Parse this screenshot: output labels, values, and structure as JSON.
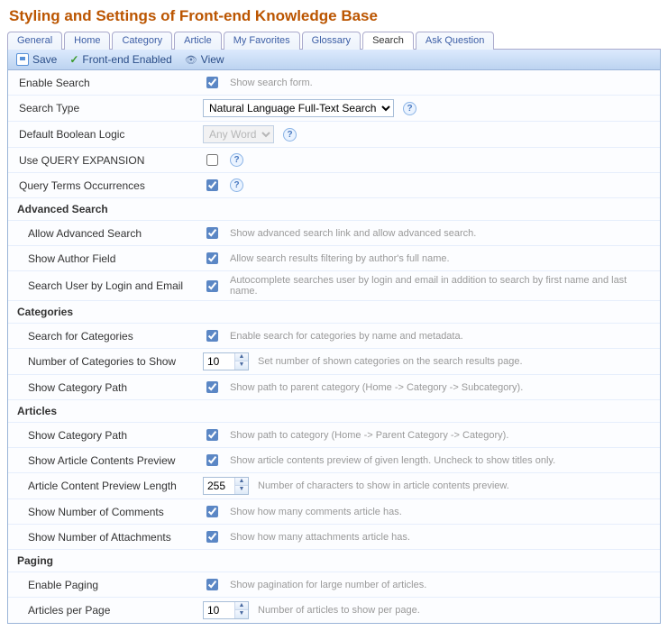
{
  "title": "Styling and Settings of Front-end Knowledge Base",
  "tabs": [
    "General",
    "Home",
    "Category",
    "Article",
    "My Favorites",
    "Glossary",
    "Search",
    "Ask Question"
  ],
  "active_tab": "Search",
  "toolbar": {
    "save": "Save",
    "enabled": "Front-end Enabled",
    "view": "View"
  },
  "rows": {
    "enable_search": {
      "label": "Enable Search",
      "desc": "Show search form."
    },
    "search_type": {
      "label": "Search Type",
      "value": "Natural Language Full-Text Search"
    },
    "boolean_logic": {
      "label": "Default Boolean Logic",
      "value": "Any Word"
    },
    "query_expansion": {
      "label": "Use QUERY EXPANSION"
    },
    "query_terms": {
      "label": "Query Terms Occurrences"
    }
  },
  "sections": {
    "advanced": "Advanced Search",
    "categories": "Categories",
    "articles": "Articles",
    "paging": "Paging"
  },
  "adv": {
    "allow": {
      "label": "Allow Advanced Search",
      "desc": "Show advanced search link and allow advanced search."
    },
    "author": {
      "label": "Show Author Field",
      "desc": "Allow search results filtering by author's full name."
    },
    "userlogin": {
      "label": "Search User by Login and Email",
      "desc": "Autocomplete searches user by login and email in addition to search by first name and last name."
    }
  },
  "cat": {
    "search": {
      "label": "Search for Categories",
      "desc": "Enable search for categories by name and metadata."
    },
    "number": {
      "label": "Number of Categories to Show",
      "value": "10",
      "desc": "Set number of shown categories on the search results page."
    },
    "path": {
      "label": "Show Category Path",
      "desc": "Show path to parent category (Home -> Category -> Subcategory)."
    }
  },
  "art": {
    "path": {
      "label": "Show Category Path",
      "desc": "Show path to category (Home -> Parent Category -> Category)."
    },
    "preview": {
      "label": "Show Article Contents Preview",
      "desc": "Show article contents preview of given length. Uncheck to show titles only."
    },
    "length": {
      "label": "Article Content Preview Length",
      "value": "255",
      "desc": "Number of characters to show in article contents preview."
    },
    "comments": {
      "label": "Show Number of Comments",
      "desc": "Show how many comments article has."
    },
    "attachments": {
      "label": "Show Number of Attachments",
      "desc": "Show how many attachments article has."
    }
  },
  "pag": {
    "enable": {
      "label": "Enable Paging",
      "desc": "Show pagination for large number of articles."
    },
    "perpage": {
      "label": "Articles per Page",
      "value": "10",
      "desc": "Number of articles to show per page."
    }
  }
}
